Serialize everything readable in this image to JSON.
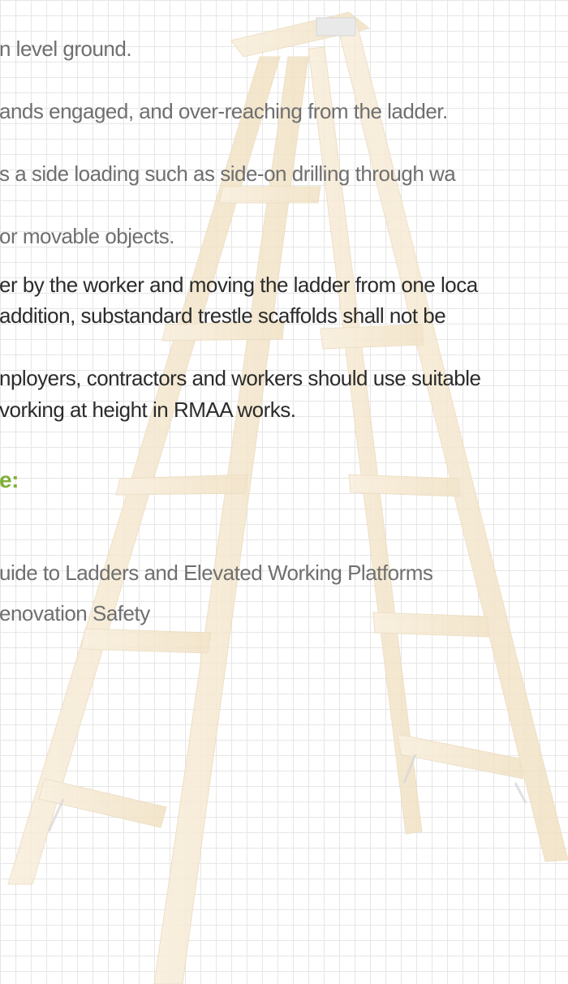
{
  "document": {
    "bullets": [
      {
        "text": "n level ground."
      },
      {
        "text": "ands engaged, and over-reaching from the ladder."
      },
      {
        "text": "s a side loading such as side-on drilling through wa"
      },
      {
        "text": "or movable objects."
      }
    ],
    "paragraph1": [
      "er by the worker and moving the ladder from one loca",
      "addition, substandard trestle scaffolds shall not be"
    ],
    "paragraph2": [
      "nployers, contractors and workers should use suitable",
      "vorking at height in RMAA works."
    ],
    "section_heading": "e:",
    "references": [
      "uide to Ladders and Elevated Working Platforms",
      "enovation Safety"
    ]
  },
  "colors": {
    "heading": "#7fb038",
    "text_dark": "#2b2b2b",
    "text_faint": "#6f6f6f",
    "ladder_wood": "#f5e6cc"
  },
  "icons": {
    "background_image": "stepladder-illustration"
  }
}
